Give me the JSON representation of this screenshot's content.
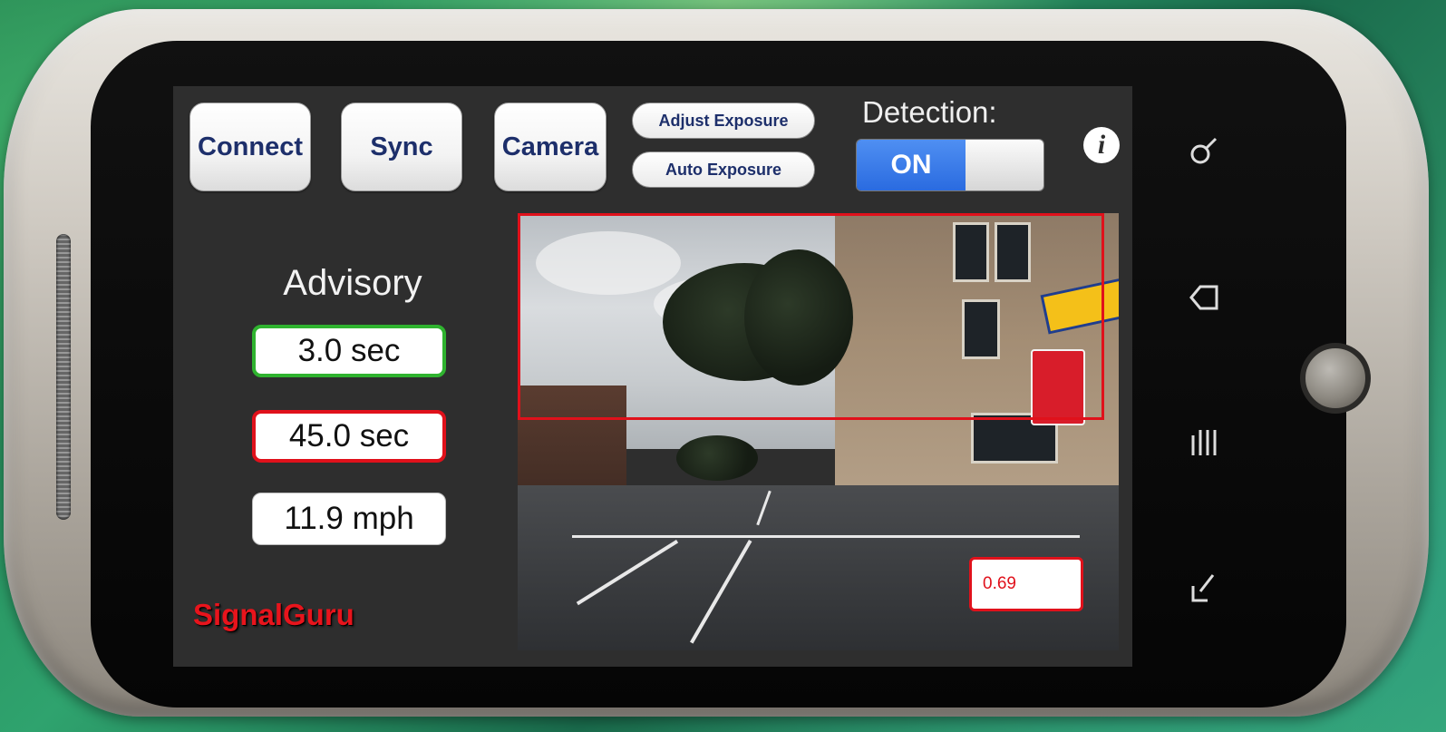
{
  "toolbar": {
    "connect_label": "Connect",
    "sync_label": "Sync",
    "camera_label": "Camera",
    "adjust_exposure_label": "Adjust Exposure",
    "auto_exposure_label": "Auto Exposure"
  },
  "detection": {
    "label": "Detection:",
    "toggle_state": "ON"
  },
  "info_button": "i",
  "advisory": {
    "title": "Advisory",
    "time_to_green": "3.0 sec",
    "time_to_red": "45.0 sec",
    "speed": "11.9 mph"
  },
  "brand": "SignalGuru",
  "camera_view": {
    "confidence": "0.69"
  },
  "colors": {
    "accent_red": "#e0111b",
    "accent_green": "#2fb32f",
    "toggle_blue": "#2a6be0",
    "button_text": "#1d2f6b",
    "screen_bg": "#2e2e2e"
  },
  "icons": {
    "device_nav": [
      "search-icon",
      "back-icon",
      "menu-icon",
      "return-icon"
    ]
  }
}
